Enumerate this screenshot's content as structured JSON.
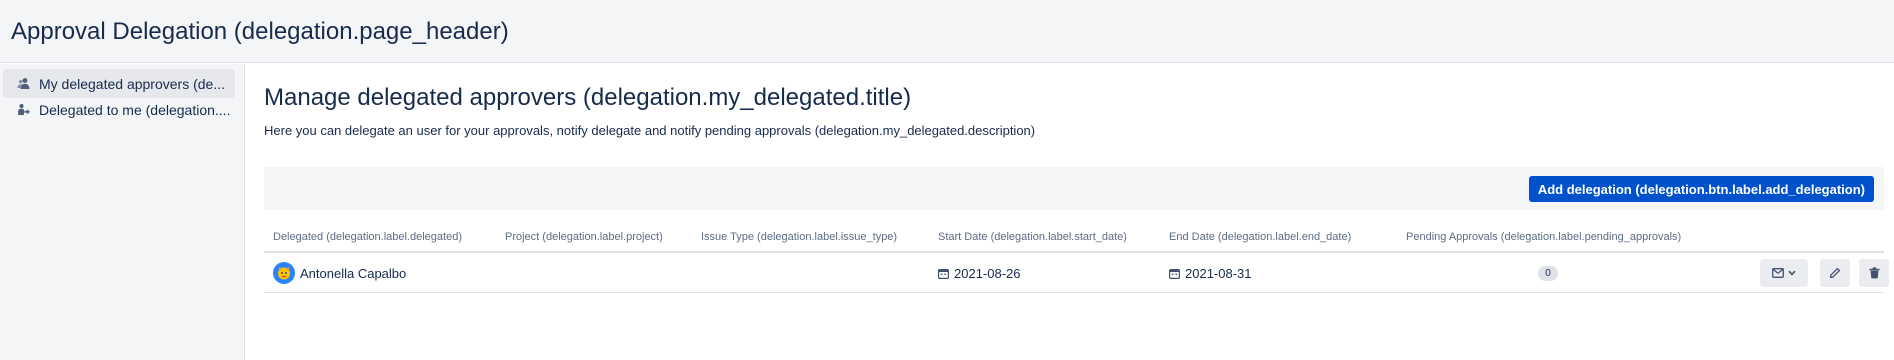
{
  "header": {
    "title": "Approval Delegation (delegation.page_header)"
  },
  "sidebar": {
    "items": [
      {
        "label": "My delegated approvers (de...",
        "icon": "users-icon",
        "active": true
      },
      {
        "label": "Delegated to me (delegation....",
        "icon": "delegate-arrow-icon",
        "active": false
      }
    ]
  },
  "main": {
    "title": "Manage delegated approvers (delegation.my_delegated.title)",
    "description": "Here you can delegate an user for your approvals, notify delegate and notify pending approvals (delegation.my_delegated.description)",
    "add_button_label": "Add delegation (delegation.btn.label.add_delegation)"
  },
  "table": {
    "columns": [
      "Delegated (delegation.label.delegated)",
      "Project (delegation.label.project)",
      "Issue Type (delegation.label.issue_type)",
      "Start Date (delegation.label.start_date)",
      "End Date (delegation.label.end_date)",
      "Pending Approvals (delegation.label.pending_approvals)"
    ],
    "rows": [
      {
        "delegated": "Antonella Capalbo",
        "project": "",
        "issue_type": "",
        "start_date": "2021-08-26",
        "end_date": "2021-08-31",
        "pending_approvals": "0",
        "actions": [
          "mail-dropdown-icon",
          "edit-icon",
          "trash-icon"
        ]
      }
    ]
  },
  "colors": {
    "primary": "#0052cc",
    "header_bg": "#f4f5f7",
    "text": "#172b4d",
    "muted": "#5e6c84",
    "border": "#dfe1e6"
  }
}
